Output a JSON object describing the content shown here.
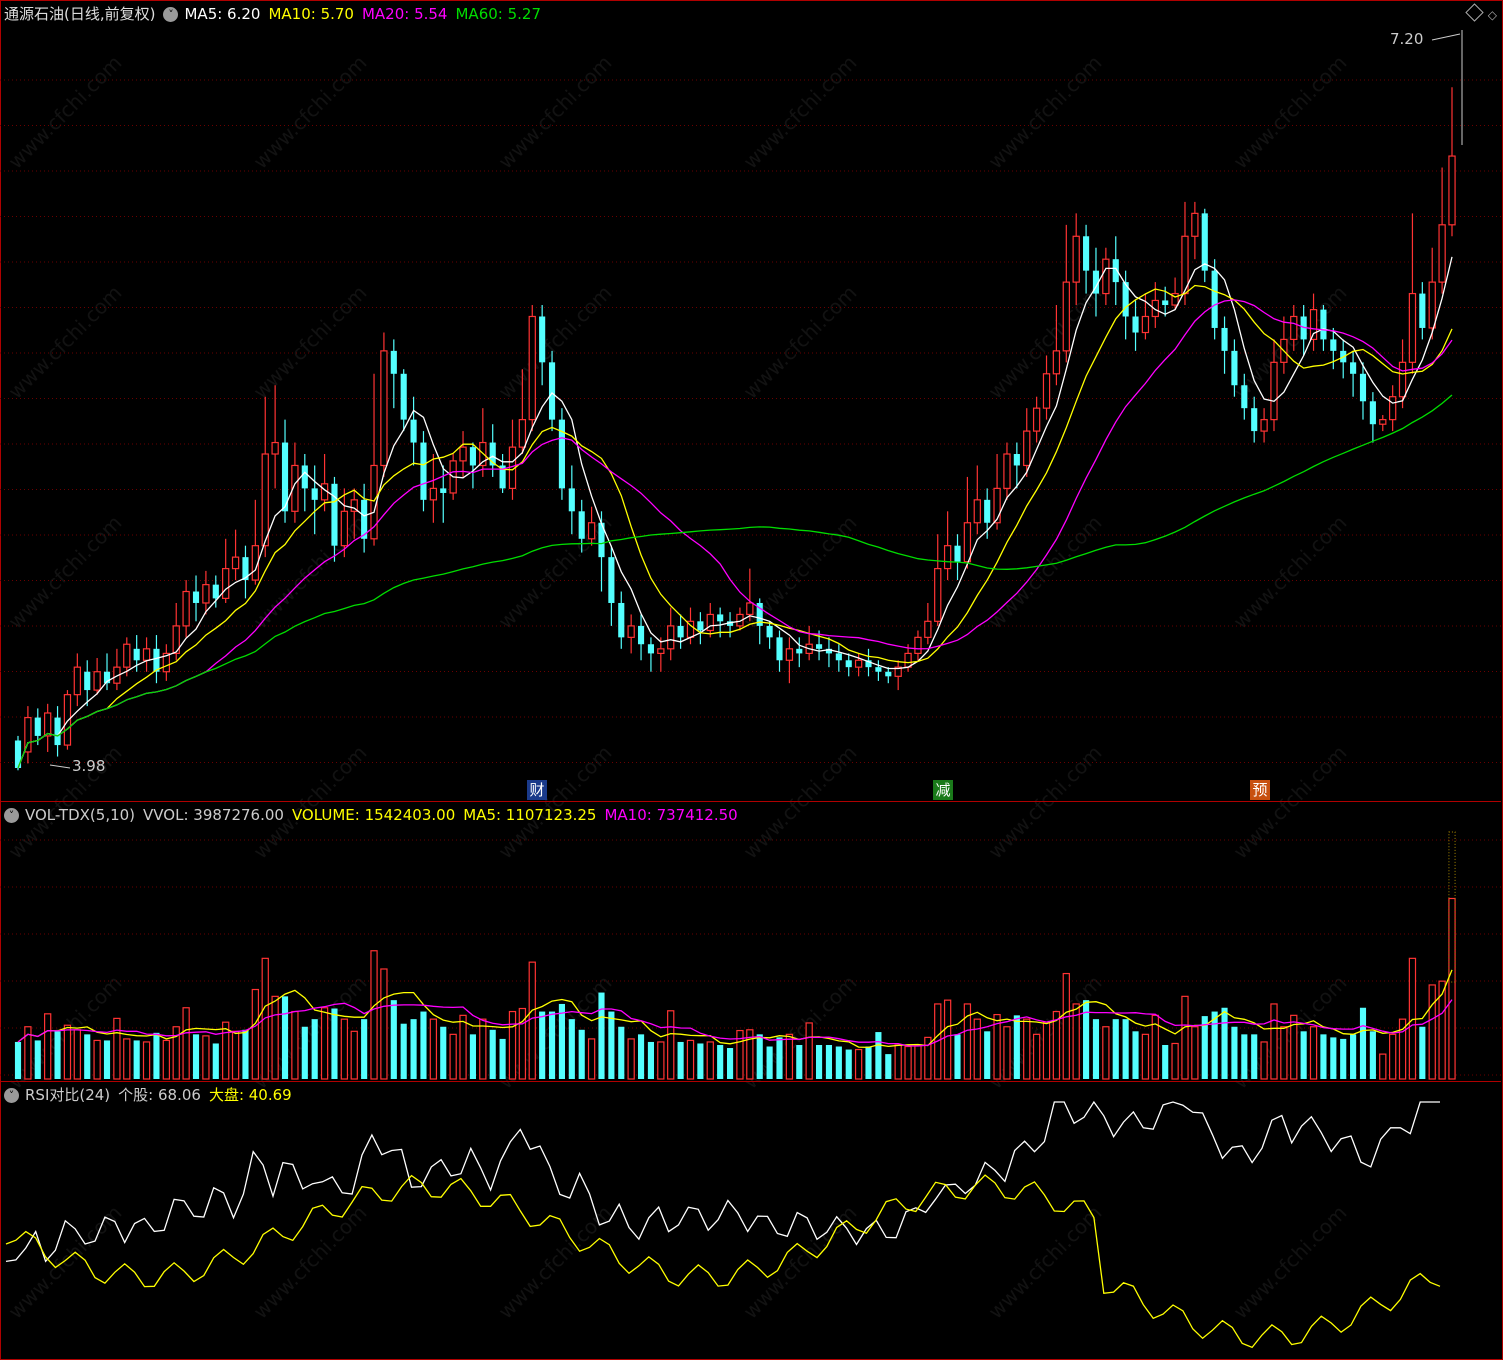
{
  "header": {
    "stock_title": "通源石油(日线,前复权)",
    "ma5": "MA5: 6.20",
    "ma10": "MA10: 5.70",
    "ma20": "MA20: 5.54",
    "ma60": "MA60: 5.27",
    "high_label": "7.20",
    "low_label": "3.98"
  },
  "events": {
    "cai": "财",
    "jian": "减",
    "yu": "预"
  },
  "volume_panel": {
    "name": "VOL-TDX(5,10)",
    "vvol": "VVOL: 3987276.00",
    "volume": "VOLUME: 1542403.00",
    "ma5": "MA5: 1107123.25",
    "ma10": "MA10: 737412.50"
  },
  "rsi_panel": {
    "name": "RSI对比(24)",
    "stock": "个股: 68.06",
    "market": "大盘: 40.69"
  },
  "watermark": "www.cfchi.com",
  "colors": {
    "up": "#ff3333",
    "down": "#54ffff",
    "ma5": "#ffffff",
    "ma10": "#ffff00",
    "ma20": "#ff00ff",
    "ma60": "#00dd00"
  },
  "chart_data": {
    "type": "candlestick",
    "price_range": [
      3.98,
      7.2
    ],
    "candles": [
      [
        4.1,
        3.98,
        4.12,
        3.97
      ],
      [
        4.05,
        4.2,
        4.25,
        4.0
      ],
      [
        4.2,
        4.12,
        4.24,
        4.08
      ],
      [
        4.12,
        4.22,
        4.26,
        4.05
      ],
      [
        4.2,
        4.08,
        4.25,
        4.03
      ],
      [
        4.08,
        4.3,
        4.32,
        4.06
      ],
      [
        4.3,
        4.42,
        4.48,
        4.25
      ],
      [
        4.4,
        4.32,
        4.45,
        4.25
      ],
      [
        4.32,
        4.4,
        4.46,
        4.3
      ],
      [
        4.4,
        4.35,
        4.48,
        4.32
      ],
      [
        4.35,
        4.42,
        4.5,
        4.32
      ],
      [
        4.42,
        4.52,
        4.55,
        4.38
      ],
      [
        4.5,
        4.45,
        4.56,
        4.4
      ],
      [
        4.45,
        4.5,
        4.55,
        4.4
      ],
      [
        4.5,
        4.4,
        4.56,
        4.35
      ],
      [
        4.4,
        4.48,
        4.52,
        4.36
      ],
      [
        4.48,
        4.6,
        4.7,
        4.45
      ],
      [
        4.6,
        4.75,
        4.8,
        4.55
      ],
      [
        4.75,
        4.7,
        4.82,
        4.62
      ],
      [
        4.7,
        4.78,
        4.84,
        4.65
      ],
      [
        4.78,
        4.72,
        4.82,
        4.68
      ],
      [
        4.72,
        4.85,
        4.98,
        4.7
      ],
      [
        4.85,
        4.9,
        5.02,
        4.8
      ],
      [
        4.9,
        4.8,
        4.95,
        4.72
      ],
      [
        4.8,
        4.95,
        5.15,
        4.78
      ],
      [
        4.95,
        5.35,
        5.6,
        4.9
      ],
      [
        5.35,
        5.4,
        5.65,
        5.2
      ],
      [
        5.4,
        5.1,
        5.5,
        5.05
      ],
      [
        5.1,
        5.3,
        5.4,
        5.05
      ],
      [
        5.3,
        5.2,
        5.35,
        5.1
      ],
      [
        5.2,
        5.15,
        5.3,
        5.0
      ],
      [
        5.15,
        5.22,
        5.35,
        5.1
      ],
      [
        5.22,
        4.95,
        5.25,
        4.88
      ],
      [
        4.95,
        5.1,
        5.2,
        4.9
      ],
      [
        5.1,
        5.15,
        5.2,
        4.98
      ],
      [
        5.15,
        4.98,
        5.22,
        4.92
      ],
      [
        4.98,
        5.3,
        5.7,
        4.95
      ],
      [
        5.3,
        5.8,
        5.88,
        5.25
      ],
      [
        5.8,
        5.7,
        5.85,
        5.55
      ],
      [
        5.7,
        5.5,
        5.72,
        5.45
      ],
      [
        5.5,
        5.4,
        5.6,
        5.3
      ],
      [
        5.4,
        5.15,
        5.45,
        5.1
      ],
      [
        5.15,
        5.2,
        5.35,
        5.05
      ],
      [
        5.2,
        5.18,
        5.3,
        5.05
      ],
      [
        5.18,
        5.32,
        5.35,
        5.15
      ],
      [
        5.32,
        5.38,
        5.45,
        5.25
      ],
      [
        5.38,
        5.3,
        5.4,
        5.2
      ],
      [
        5.3,
        5.4,
        5.55,
        5.25
      ],
      [
        5.4,
        5.3,
        5.48,
        5.25
      ],
      [
        5.3,
        5.2,
        5.35,
        5.18
      ],
      [
        5.2,
        5.38,
        5.5,
        5.15
      ],
      [
        5.38,
        5.5,
        5.72,
        5.35
      ],
      [
        5.5,
        5.95,
        6.0,
        5.45
      ],
      [
        5.95,
        5.75,
        6.0,
        5.65
      ],
      [
        5.75,
        5.5,
        5.8,
        5.45
      ],
      [
        5.5,
        5.2,
        5.55,
        5.15
      ],
      [
        5.2,
        5.1,
        5.3,
        5.0
      ],
      [
        5.1,
        4.98,
        5.15,
        4.92
      ],
      [
        4.98,
        5.05,
        5.12,
        4.95
      ],
      [
        5.05,
        4.9,
        5.1,
        4.75
      ],
      [
        4.9,
        4.7,
        4.95,
        4.6
      ],
      [
        4.7,
        4.55,
        4.75,
        4.5
      ],
      [
        4.55,
        4.6,
        4.65,
        4.48
      ],
      [
        4.6,
        4.52,
        4.65,
        4.45
      ],
      [
        4.52,
        4.48,
        4.55,
        4.4
      ],
      [
        4.48,
        4.5,
        4.55,
        4.4
      ],
      [
        4.5,
        4.6,
        4.68,
        4.45
      ],
      [
        4.6,
        4.55,
        4.65,
        4.5
      ],
      [
        4.55,
        4.62,
        4.68,
        4.52
      ],
      [
        4.62,
        4.58,
        4.66,
        4.52
      ],
      [
        4.58,
        4.65,
        4.7,
        4.55
      ],
      [
        4.65,
        4.62,
        4.68,
        4.55
      ],
      [
        4.62,
        4.6,
        4.66,
        4.55
      ],
      [
        4.6,
        4.65,
        4.68,
        4.58
      ],
      [
        4.65,
        4.7,
        4.85,
        4.62
      ],
      [
        4.7,
        4.6,
        4.72,
        4.52
      ],
      [
        4.6,
        4.55,
        4.62,
        4.5
      ],
      [
        4.55,
        4.45,
        4.58,
        4.4
      ],
      [
        4.45,
        4.5,
        4.55,
        4.35
      ],
      [
        4.5,
        4.48,
        4.55,
        4.42
      ],
      [
        4.48,
        4.52,
        4.6,
        4.45
      ],
      [
        4.52,
        4.5,
        4.58,
        4.45
      ],
      [
        4.5,
        4.48,
        4.55,
        4.42
      ],
      [
        4.48,
        4.45,
        4.52,
        4.4
      ],
      [
        4.45,
        4.42,
        4.48,
        4.38
      ],
      [
        4.42,
        4.45,
        4.48,
        4.38
      ],
      [
        4.45,
        4.42,
        4.5,
        4.38
      ],
      [
        4.42,
        4.4,
        4.45,
        4.36
      ],
      [
        4.4,
        4.38,
        4.42,
        4.35
      ],
      [
        4.38,
        4.42,
        4.45,
        4.32
      ],
      [
        4.42,
        4.48,
        4.52,
        4.4
      ],
      [
        4.48,
        4.55,
        4.58,
        4.45
      ],
      [
        4.55,
        4.62,
        4.7,
        4.52
      ],
      [
        4.62,
        4.85,
        5.0,
        4.6
      ],
      [
        4.85,
        4.95,
        5.1,
        4.8
      ],
      [
        4.95,
        4.88,
        5.0,
        4.8
      ],
      [
        4.88,
        5.05,
        5.25,
        4.85
      ],
      [
        5.05,
        5.15,
        5.3,
        5.0
      ],
      [
        5.15,
        5.05,
        5.2,
        4.98
      ],
      [
        5.05,
        5.2,
        5.35,
        5.02
      ],
      [
        5.2,
        5.35,
        5.4,
        5.15
      ],
      [
        5.35,
        5.3,
        5.4,
        5.2
      ],
      [
        5.3,
        5.45,
        5.55,
        5.25
      ],
      [
        5.45,
        5.55,
        5.6,
        5.4
      ],
      [
        5.55,
        5.7,
        5.78,
        5.5
      ],
      [
        5.7,
        5.8,
        6.0,
        5.65
      ],
      [
        5.8,
        6.1,
        6.35,
        5.75
      ],
      [
        6.1,
        6.3,
        6.4,
        6.0
      ],
      [
        6.3,
        6.15,
        6.35,
        6.05
      ],
      [
        6.15,
        6.05,
        6.25,
        5.95
      ],
      [
        6.05,
        6.2,
        6.25,
        6.0
      ],
      [
        6.2,
        6.1,
        6.3,
        6.0
      ],
      [
        6.1,
        5.95,
        6.15,
        5.85
      ],
      [
        5.95,
        5.88,
        6.02,
        5.8
      ],
      [
        5.88,
        5.95,
        6.05,
        5.85
      ],
      [
        5.95,
        6.02,
        6.1,
        5.9
      ],
      [
        6.02,
        6.0,
        6.08,
        5.95
      ],
      [
        6.0,
        6.05,
        6.12,
        5.98
      ],
      [
        6.05,
        6.3,
        6.45,
        6.0
      ],
      [
        6.3,
        6.4,
        6.45,
        6.2
      ],
      [
        6.4,
        6.15,
        6.42,
        6.1
      ],
      [
        6.15,
        5.9,
        6.2,
        5.85
      ],
      [
        5.9,
        5.8,
        5.95,
        5.7
      ],
      [
        5.8,
        5.65,
        5.85,
        5.6
      ],
      [
        5.65,
        5.55,
        5.7,
        5.5
      ],
      [
        5.55,
        5.45,
        5.6,
        5.4
      ],
      [
        5.45,
        5.5,
        5.55,
        5.4
      ],
      [
        5.5,
        5.75,
        5.85,
        5.45
      ],
      [
        5.75,
        5.85,
        5.95,
        5.7
      ],
      [
        5.85,
        5.95,
        6.0,
        5.8
      ],
      [
        5.95,
        5.85,
        6.0,
        5.78
      ],
      [
        5.85,
        5.98,
        6.05,
        5.8
      ],
      [
        5.98,
        5.85,
        6.0,
        5.8
      ],
      [
        5.85,
        5.8,
        5.9,
        5.72
      ],
      [
        5.8,
        5.75,
        5.85,
        5.68
      ],
      [
        5.75,
        5.7,
        5.8,
        5.6
      ],
      [
        5.7,
        5.58,
        5.75,
        5.5
      ],
      [
        5.58,
        5.48,
        5.62,
        5.4
      ],
      [
        5.48,
        5.5,
        5.52,
        5.45
      ],
      [
        5.5,
        5.6,
        5.65,
        5.45
      ],
      [
        5.6,
        5.75,
        5.85,
        5.55
      ],
      [
        5.75,
        6.05,
        6.4,
        5.7
      ],
      [
        6.05,
        5.9,
        6.1,
        5.85
      ],
      [
        5.9,
        6.1,
        6.25,
        5.85
      ],
      [
        6.1,
        6.35,
        6.6,
        6.05
      ],
      [
        6.35,
        6.65,
        6.95,
        6.3
      ]
    ]
  }
}
